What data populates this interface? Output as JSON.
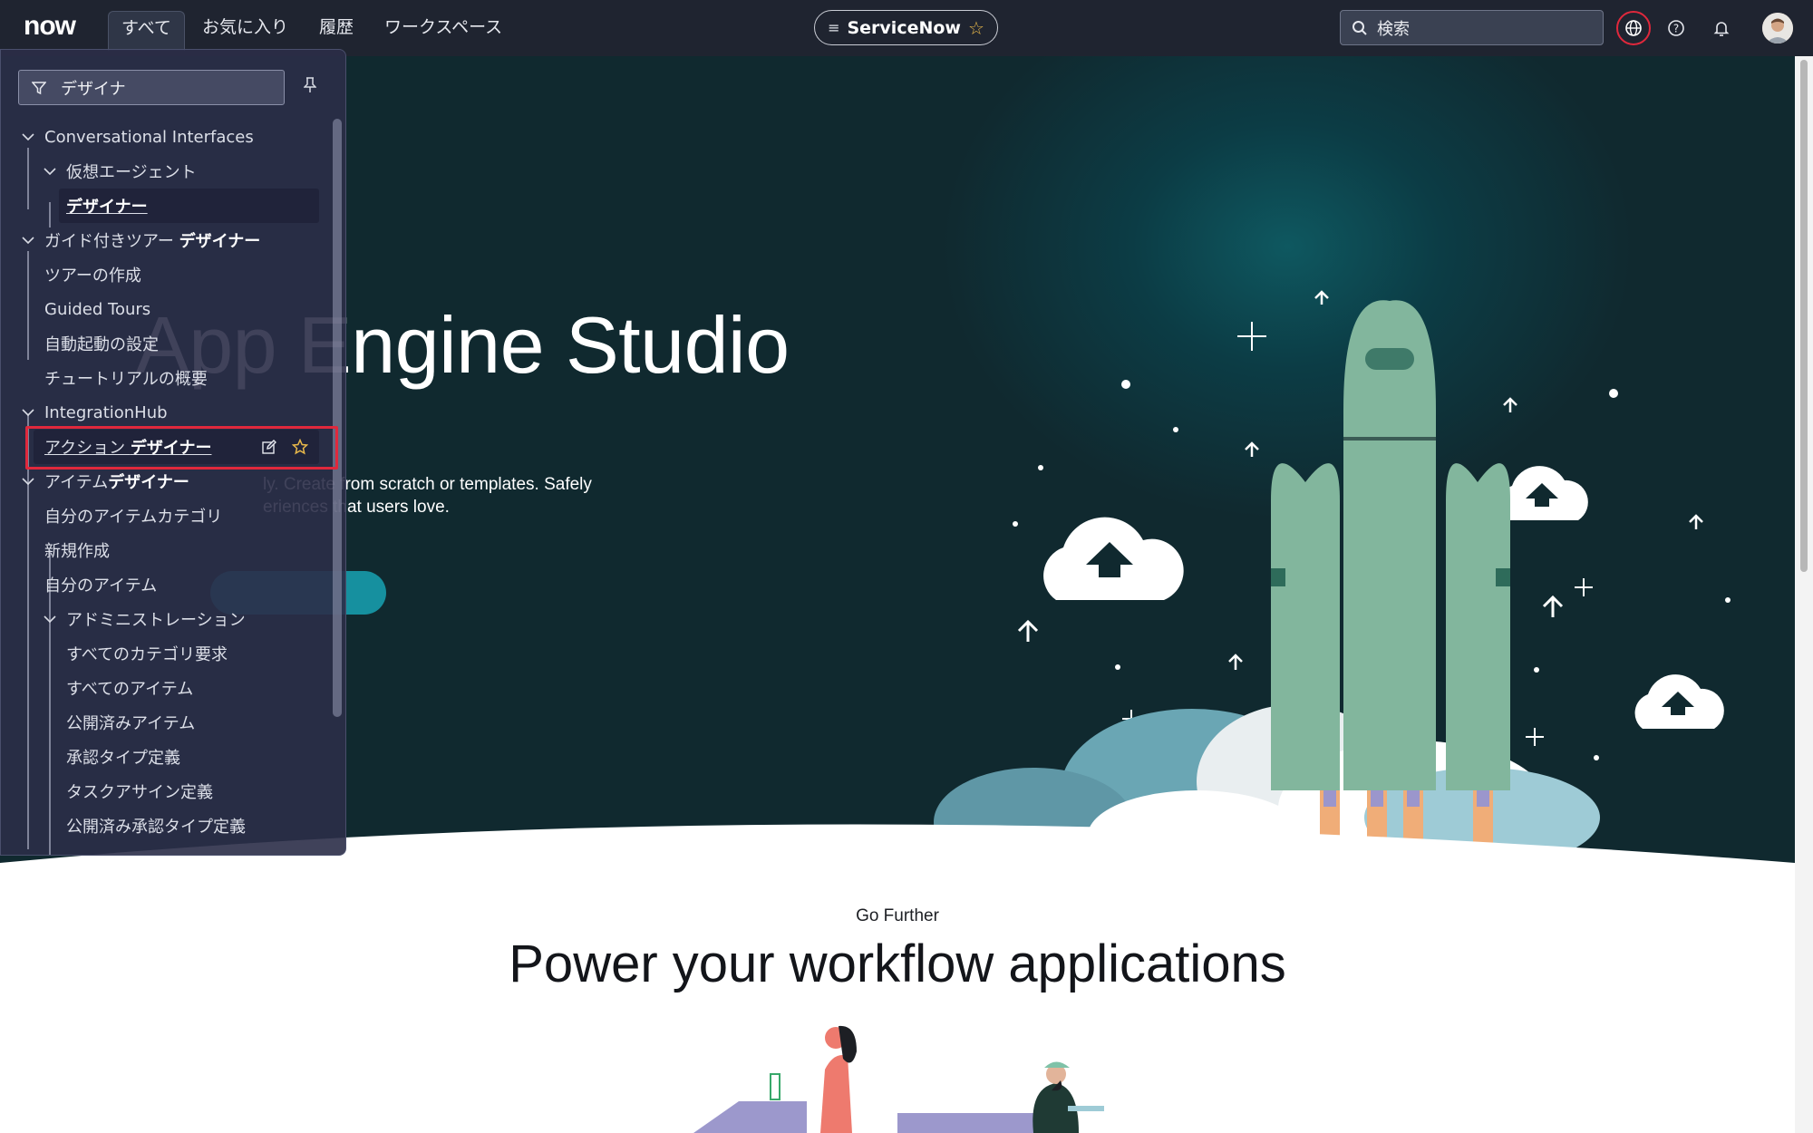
{
  "topnav": {
    "logo": "now",
    "tabs": [
      "すべて",
      "お気に入り",
      "履歴",
      "ワークスペース"
    ],
    "active_tab": "すべて",
    "app_pill": "ServiceNow",
    "search_placeholder": "検索"
  },
  "menu": {
    "filter_value": "デザイナ",
    "sections": {
      "conv": "Conversational Interfaces",
      "virtual_agent": "仮想エージェント",
      "va_designer": "デザイナー",
      "guided_tour_prefix": "ガイド付きツアー ",
      "guided_tour_bold": "デザイナー",
      "tour_create": "ツアーの作成",
      "guided_tours": "Guided Tours",
      "autostart": "自動起動の設定",
      "tutorial": "チュートリアルの概要",
      "integrationhub": "IntegrationHub",
      "action_prefix": "アクション ",
      "action_bold": "デザイナー",
      "item_prefix": "アイテム",
      "item_bold": "デザイナー",
      "my_categories": "自分のアイテムカテゴリ",
      "new": "新規作成",
      "my_items": "自分のアイテム",
      "admin": "アドミニストレーション",
      "all_category_requests": "すべてのカテゴリ要求",
      "all_items": "すべてのアイテム",
      "published_items": "公開済みアイテム",
      "approval_types": "承認タイプ定義",
      "task_assign": "タスクアサイン定義",
      "published_approval_types": "公開済み承認タイプ定義"
    }
  },
  "hero": {
    "title": "App Engine Studio",
    "description": "ly. Create from scratch or templates. Safely\neriences that users love."
  },
  "section": {
    "eyebrow": "Go Further",
    "title": "Power your workflow applications"
  },
  "colors": {
    "topbar": "#1f2430",
    "hero_bg": "#10292f",
    "accent_red": "#e0283c",
    "rocket": "#82b69d",
    "favorite_star": "#e8b84a"
  }
}
